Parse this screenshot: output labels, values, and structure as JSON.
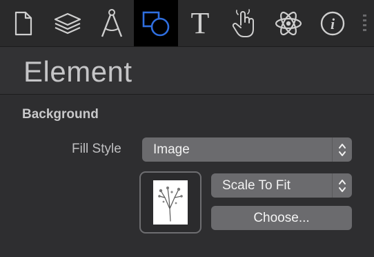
{
  "toolbar": {
    "tools": [
      {
        "icon": "document-icon"
      },
      {
        "icon": "layers-icon"
      },
      {
        "icon": "compass-icon"
      },
      {
        "icon": "shapes-icon",
        "active": true
      },
      {
        "icon": "text-tool-icon",
        "glyph": "T"
      },
      {
        "icon": "hand-pointer-icon"
      },
      {
        "icon": "atom-icon"
      },
      {
        "icon": "info-icon",
        "glyph": "i"
      },
      {
        "icon": "more-handle-icon"
      }
    ],
    "accent_color": "#2f6fe0"
  },
  "inspector": {
    "title": "Element",
    "section": "Background",
    "fill_style_label": "Fill Style",
    "fill_style_value": "Image",
    "scale_value": "Scale To Fit",
    "choose_label": "Choose..."
  }
}
